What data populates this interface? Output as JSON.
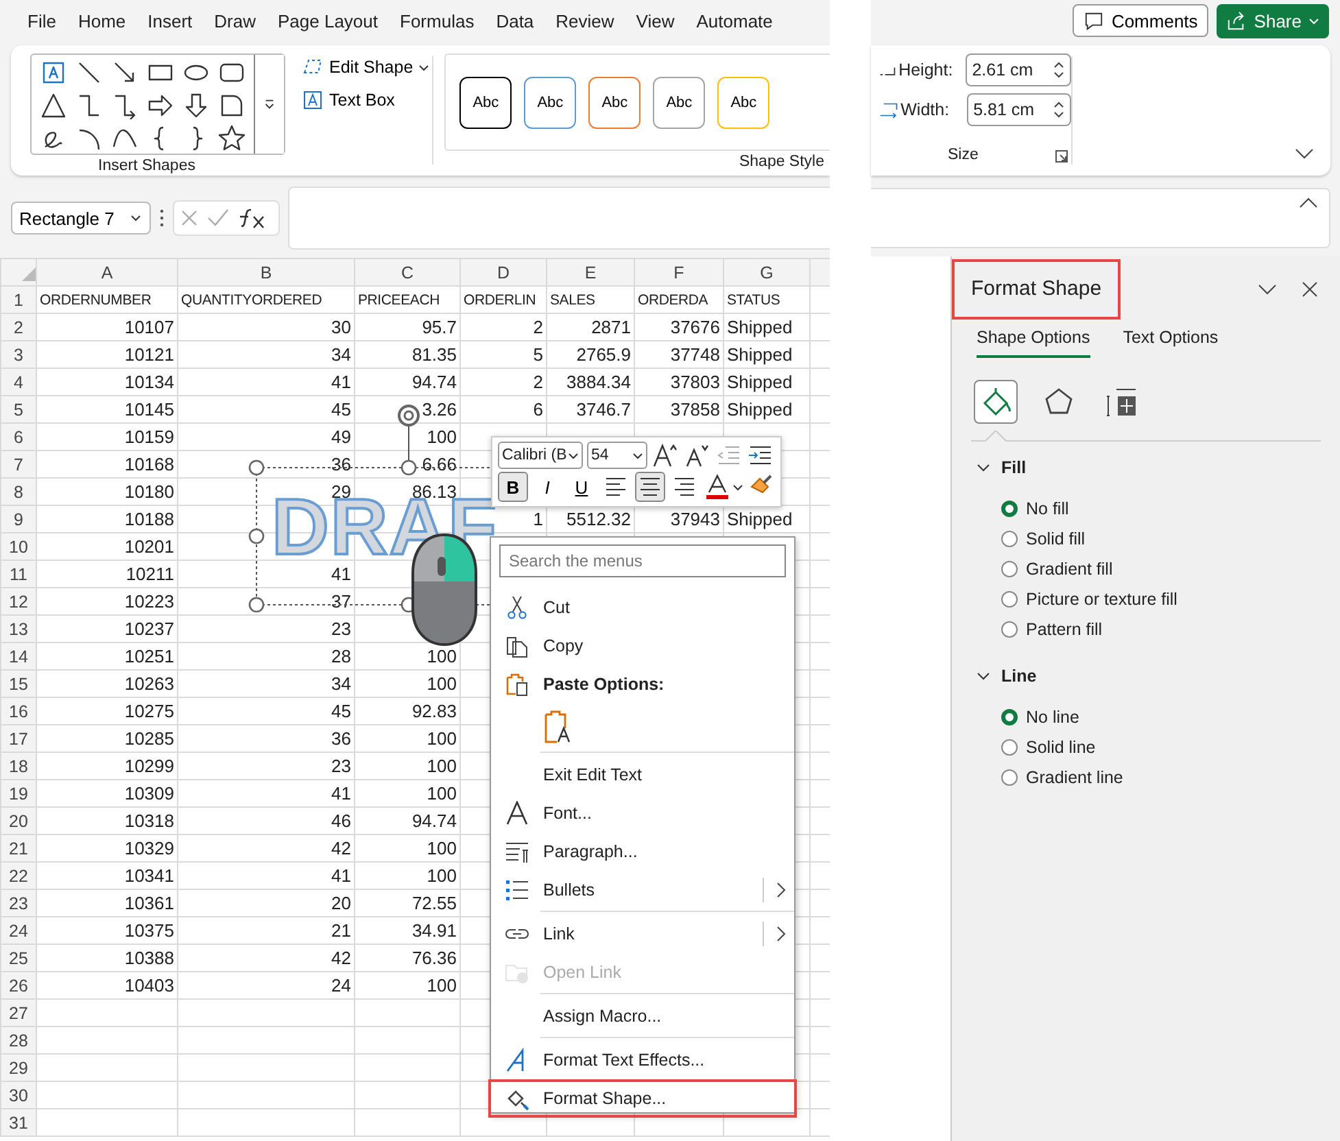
{
  "ribbon_tabs": [
    {
      "label": "File"
    },
    {
      "label": "Home"
    },
    {
      "label": "Insert"
    },
    {
      "label": "Draw"
    },
    {
      "label": "Page Layout"
    },
    {
      "label": "Formulas"
    },
    {
      "label": "Data"
    },
    {
      "label": "Review"
    },
    {
      "label": "View"
    },
    {
      "label": "Automate"
    }
  ],
  "top_buttons": {
    "comments": "Comments",
    "share": "Share"
  },
  "ribbon": {
    "edit_shape": "Edit Shape",
    "text_box": "Text Box",
    "insert_shapes_label": "Insert Shapes",
    "shape_styles": [
      {
        "label": "Abc",
        "color": "#000000"
      },
      {
        "label": "Abc",
        "color": "#5b9bd5"
      },
      {
        "label": "Abc",
        "color": "#ed7d31"
      },
      {
        "label": "Abc",
        "color": "#a5a5a5"
      },
      {
        "label": "Abc",
        "color": "#ffc000"
      }
    ],
    "shape_styles_label": "Shape Style",
    "height_label": "Height:",
    "height_value": "2.61 cm",
    "width_label": "Width:",
    "width_value": "5.81 cm",
    "size_label": "Size"
  },
  "formula_bar": {
    "name_box": "Rectangle 7"
  },
  "sheet": {
    "columns": [
      "A",
      "B",
      "C",
      "D",
      "E",
      "F",
      "G"
    ],
    "rows": [
      {
        "n": "1",
        "cells": [
          "ORDERNUMBER",
          "QUANTITYORDERED",
          "PRICEEACH",
          "ORDERLIN",
          "SALES",
          "ORDERDA",
          "STATUS"
        ]
      },
      {
        "n": "2",
        "cells": [
          "10107",
          "30",
          "95.7",
          "2",
          "2871",
          "37676",
          "Shipped"
        ]
      },
      {
        "n": "3",
        "cells": [
          "10121",
          "34",
          "81.35",
          "5",
          "2765.9",
          "37748",
          "Shipped"
        ]
      },
      {
        "n": "4",
        "cells": [
          "10134",
          "41",
          "94.74",
          "2",
          "3884.34",
          "37803",
          "Shipped"
        ]
      },
      {
        "n": "5",
        "cells": [
          "10145",
          "45",
          "3.26",
          "6",
          "3746.7",
          "37858",
          "Shipped"
        ]
      },
      {
        "n": "6",
        "cells": [
          "10159",
          "49",
          "100",
          null,
          null,
          null,
          null
        ]
      },
      {
        "n": "7",
        "cells": [
          "10168",
          "36",
          "6.66",
          null,
          null,
          null,
          null
        ]
      },
      {
        "n": "8",
        "cells": [
          "10180",
          "29",
          "86.13",
          null,
          null,
          null,
          null
        ]
      },
      {
        "n": "9",
        "cells": [
          "10188",
          null,
          null,
          "1",
          "5512.32",
          "37943",
          "Shipped"
        ]
      },
      {
        "n": "10",
        "cells": [
          "10201",
          null,
          null,
          null,
          null,
          null,
          null
        ]
      },
      {
        "n": "11",
        "cells": [
          "10211",
          "41",
          null,
          null,
          null,
          null,
          null
        ]
      },
      {
        "n": "12",
        "cells": [
          "10223",
          "37",
          null,
          null,
          null,
          null,
          null
        ]
      },
      {
        "n": "13",
        "cells": [
          "10237",
          "23",
          null,
          null,
          null,
          null,
          null
        ]
      },
      {
        "n": "14",
        "cells": [
          "10251",
          "28",
          "100",
          null,
          null,
          null,
          null
        ]
      },
      {
        "n": "15",
        "cells": [
          "10263",
          "34",
          "100",
          null,
          null,
          null,
          null
        ]
      },
      {
        "n": "16",
        "cells": [
          "10275",
          "45",
          "92.83",
          null,
          null,
          null,
          null
        ]
      },
      {
        "n": "17",
        "cells": [
          "10285",
          "36",
          "100",
          null,
          null,
          null,
          null
        ]
      },
      {
        "n": "18",
        "cells": [
          "10299",
          "23",
          "100",
          null,
          null,
          null,
          null
        ]
      },
      {
        "n": "19",
        "cells": [
          "10309",
          "41",
          "100",
          null,
          null,
          null,
          null
        ]
      },
      {
        "n": "20",
        "cells": [
          "10318",
          "46",
          "94.74",
          null,
          null,
          null,
          null
        ]
      },
      {
        "n": "21",
        "cells": [
          "10329",
          "42",
          "100",
          null,
          null,
          null,
          null
        ]
      },
      {
        "n": "22",
        "cells": [
          "10341",
          "41",
          "100",
          null,
          null,
          null,
          null
        ]
      },
      {
        "n": "23",
        "cells": [
          "10361",
          "20",
          "72.55",
          null,
          null,
          null,
          null
        ]
      },
      {
        "n": "24",
        "cells": [
          "10375",
          "21",
          "34.91",
          null,
          null,
          null,
          null
        ]
      },
      {
        "n": "25",
        "cells": [
          "10388",
          "42",
          "76.36",
          null,
          null,
          null,
          null
        ]
      },
      {
        "n": "26",
        "cells": [
          "10403",
          "24",
          "100",
          null,
          null,
          null,
          null
        ]
      },
      {
        "n": "27",
        "cells": []
      },
      {
        "n": "28",
        "cells": []
      },
      {
        "n": "29",
        "cells": []
      },
      {
        "n": "30",
        "cells": []
      },
      {
        "n": "31",
        "cells": []
      }
    ]
  },
  "shape": {
    "text": "DRAF"
  },
  "mini_toolbar": {
    "font": "Calibri (B",
    "size": "54",
    "styles": [
      {
        "label": "B",
        "selected": true
      },
      {
        "label": "I",
        "selected": false
      },
      {
        "label": "U",
        "selected": false
      }
    ],
    "aligns": [
      {
        "selected": false
      },
      {
        "selected": true
      },
      {
        "selected": false
      }
    ]
  },
  "context_menu": {
    "search": {
      "placeholder": "Search the menus"
    },
    "items": [
      {
        "kind": "item",
        "label": "Cut",
        "disabled": false,
        "submenu": false,
        "marked": false
      },
      {
        "kind": "item",
        "label": "Copy",
        "disabled": false,
        "submenu": false,
        "marked": false
      },
      {
        "kind": "header",
        "label": "Paste Options:",
        "disabled": false,
        "submenu": false,
        "marked": false
      },
      {
        "kind": "paste"
      },
      {
        "kind": "separator"
      },
      {
        "kind": "item",
        "label": "Exit Edit Text",
        "disabled": false,
        "submenu": false,
        "marked": false
      },
      {
        "kind": "item",
        "label": "Font...",
        "disabled": false,
        "submenu": false,
        "marked": false
      },
      {
        "kind": "item",
        "label": "Paragraph...",
        "disabled": false,
        "submenu": false,
        "marked": false
      },
      {
        "kind": "item",
        "label": "Bullets",
        "disabled": false,
        "submenu": true,
        "marked": false
      },
      {
        "kind": "separator"
      },
      {
        "kind": "item",
        "label": "Link",
        "disabled": false,
        "submenu": true,
        "marked": false
      },
      {
        "kind": "item",
        "label": "Open Link",
        "disabled": true,
        "submenu": false,
        "marked": false
      },
      {
        "kind": "separator"
      },
      {
        "kind": "item",
        "label": "Assign Macro...",
        "disabled": false,
        "submenu": false,
        "marked": false
      },
      {
        "kind": "separator"
      },
      {
        "kind": "item",
        "label": "Format Text Effects...",
        "disabled": false,
        "submenu": false,
        "marked": false
      },
      {
        "kind": "item",
        "label": "Format Shape...",
        "disabled": false,
        "submenu": false,
        "marked": true
      }
    ]
  },
  "format_pane": {
    "title": "Format Shape",
    "tabs": [
      {
        "label": "Shape Options",
        "selected": true
      },
      {
        "label": "Text Options",
        "selected": false
      }
    ],
    "categories": [
      {
        "selected": true
      },
      {
        "selected": false
      },
      {
        "selected": false
      }
    ],
    "sections": [
      {
        "title": "Fill",
        "expanded": true,
        "options": [
          {
            "label": "No fill",
            "selected": true
          },
          {
            "label": "Solid fill",
            "selected": false
          },
          {
            "label": "Gradient fill",
            "selected": false
          },
          {
            "label": "Picture or texture fill",
            "selected": false
          },
          {
            "label": "Pattern fill",
            "selected": false
          }
        ]
      },
      {
        "title": "Line",
        "expanded": true,
        "options": [
          {
            "label": "No line",
            "selected": true
          },
          {
            "label": "Solid line",
            "selected": false
          },
          {
            "label": "Gradient line",
            "selected": false
          }
        ]
      }
    ]
  }
}
